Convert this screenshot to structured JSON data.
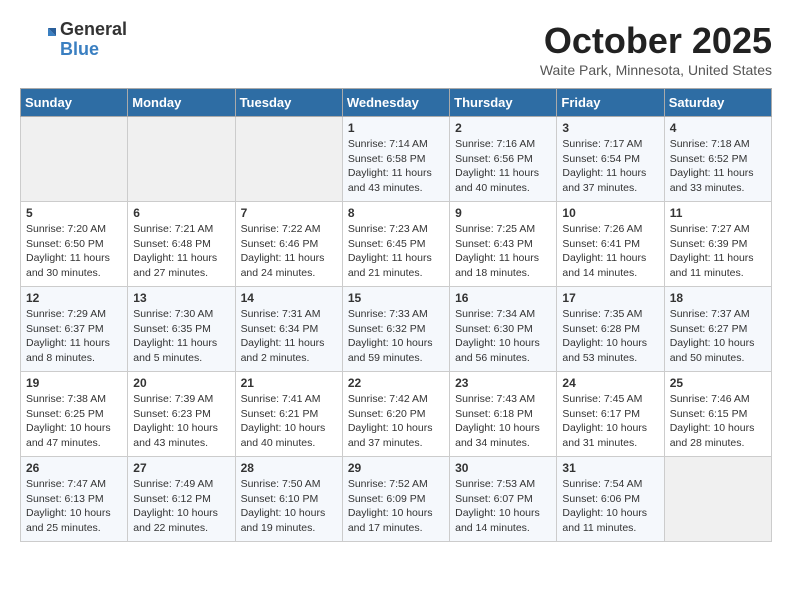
{
  "header": {
    "logo_general": "General",
    "logo_blue": "Blue",
    "month_title": "October 2025",
    "location": "Waite Park, Minnesota, United States"
  },
  "weekdays": [
    "Sunday",
    "Monday",
    "Tuesday",
    "Wednesday",
    "Thursday",
    "Friday",
    "Saturday"
  ],
  "weeks": [
    [
      {
        "day": "",
        "info": ""
      },
      {
        "day": "",
        "info": ""
      },
      {
        "day": "",
        "info": ""
      },
      {
        "day": "1",
        "info": "Sunrise: 7:14 AM\nSunset: 6:58 PM\nDaylight: 11 hours\nand 43 minutes."
      },
      {
        "day": "2",
        "info": "Sunrise: 7:16 AM\nSunset: 6:56 PM\nDaylight: 11 hours\nand 40 minutes."
      },
      {
        "day": "3",
        "info": "Sunrise: 7:17 AM\nSunset: 6:54 PM\nDaylight: 11 hours\nand 37 minutes."
      },
      {
        "day": "4",
        "info": "Sunrise: 7:18 AM\nSunset: 6:52 PM\nDaylight: 11 hours\nand 33 minutes."
      }
    ],
    [
      {
        "day": "5",
        "info": "Sunrise: 7:20 AM\nSunset: 6:50 PM\nDaylight: 11 hours\nand 30 minutes."
      },
      {
        "day": "6",
        "info": "Sunrise: 7:21 AM\nSunset: 6:48 PM\nDaylight: 11 hours\nand 27 minutes."
      },
      {
        "day": "7",
        "info": "Sunrise: 7:22 AM\nSunset: 6:46 PM\nDaylight: 11 hours\nand 24 minutes."
      },
      {
        "day": "8",
        "info": "Sunrise: 7:23 AM\nSunset: 6:45 PM\nDaylight: 11 hours\nand 21 minutes."
      },
      {
        "day": "9",
        "info": "Sunrise: 7:25 AM\nSunset: 6:43 PM\nDaylight: 11 hours\nand 18 minutes."
      },
      {
        "day": "10",
        "info": "Sunrise: 7:26 AM\nSunset: 6:41 PM\nDaylight: 11 hours\nand 14 minutes."
      },
      {
        "day": "11",
        "info": "Sunrise: 7:27 AM\nSunset: 6:39 PM\nDaylight: 11 hours\nand 11 minutes."
      }
    ],
    [
      {
        "day": "12",
        "info": "Sunrise: 7:29 AM\nSunset: 6:37 PM\nDaylight: 11 hours\nand 8 minutes."
      },
      {
        "day": "13",
        "info": "Sunrise: 7:30 AM\nSunset: 6:35 PM\nDaylight: 11 hours\nand 5 minutes."
      },
      {
        "day": "14",
        "info": "Sunrise: 7:31 AM\nSunset: 6:34 PM\nDaylight: 11 hours\nand 2 minutes."
      },
      {
        "day": "15",
        "info": "Sunrise: 7:33 AM\nSunset: 6:32 PM\nDaylight: 10 hours\nand 59 minutes."
      },
      {
        "day": "16",
        "info": "Sunrise: 7:34 AM\nSunset: 6:30 PM\nDaylight: 10 hours\nand 56 minutes."
      },
      {
        "day": "17",
        "info": "Sunrise: 7:35 AM\nSunset: 6:28 PM\nDaylight: 10 hours\nand 53 minutes."
      },
      {
        "day": "18",
        "info": "Sunrise: 7:37 AM\nSunset: 6:27 PM\nDaylight: 10 hours\nand 50 minutes."
      }
    ],
    [
      {
        "day": "19",
        "info": "Sunrise: 7:38 AM\nSunset: 6:25 PM\nDaylight: 10 hours\nand 47 minutes."
      },
      {
        "day": "20",
        "info": "Sunrise: 7:39 AM\nSunset: 6:23 PM\nDaylight: 10 hours\nand 43 minutes."
      },
      {
        "day": "21",
        "info": "Sunrise: 7:41 AM\nSunset: 6:21 PM\nDaylight: 10 hours\nand 40 minutes."
      },
      {
        "day": "22",
        "info": "Sunrise: 7:42 AM\nSunset: 6:20 PM\nDaylight: 10 hours\nand 37 minutes."
      },
      {
        "day": "23",
        "info": "Sunrise: 7:43 AM\nSunset: 6:18 PM\nDaylight: 10 hours\nand 34 minutes."
      },
      {
        "day": "24",
        "info": "Sunrise: 7:45 AM\nSunset: 6:17 PM\nDaylight: 10 hours\nand 31 minutes."
      },
      {
        "day": "25",
        "info": "Sunrise: 7:46 AM\nSunset: 6:15 PM\nDaylight: 10 hours\nand 28 minutes."
      }
    ],
    [
      {
        "day": "26",
        "info": "Sunrise: 7:47 AM\nSunset: 6:13 PM\nDaylight: 10 hours\nand 25 minutes."
      },
      {
        "day": "27",
        "info": "Sunrise: 7:49 AM\nSunset: 6:12 PM\nDaylight: 10 hours\nand 22 minutes."
      },
      {
        "day": "28",
        "info": "Sunrise: 7:50 AM\nSunset: 6:10 PM\nDaylight: 10 hours\nand 19 minutes."
      },
      {
        "day": "29",
        "info": "Sunrise: 7:52 AM\nSunset: 6:09 PM\nDaylight: 10 hours\nand 17 minutes."
      },
      {
        "day": "30",
        "info": "Sunrise: 7:53 AM\nSunset: 6:07 PM\nDaylight: 10 hours\nand 14 minutes."
      },
      {
        "day": "31",
        "info": "Sunrise: 7:54 AM\nSunset: 6:06 PM\nDaylight: 10 hours\nand 11 minutes."
      },
      {
        "day": "",
        "info": ""
      }
    ]
  ]
}
